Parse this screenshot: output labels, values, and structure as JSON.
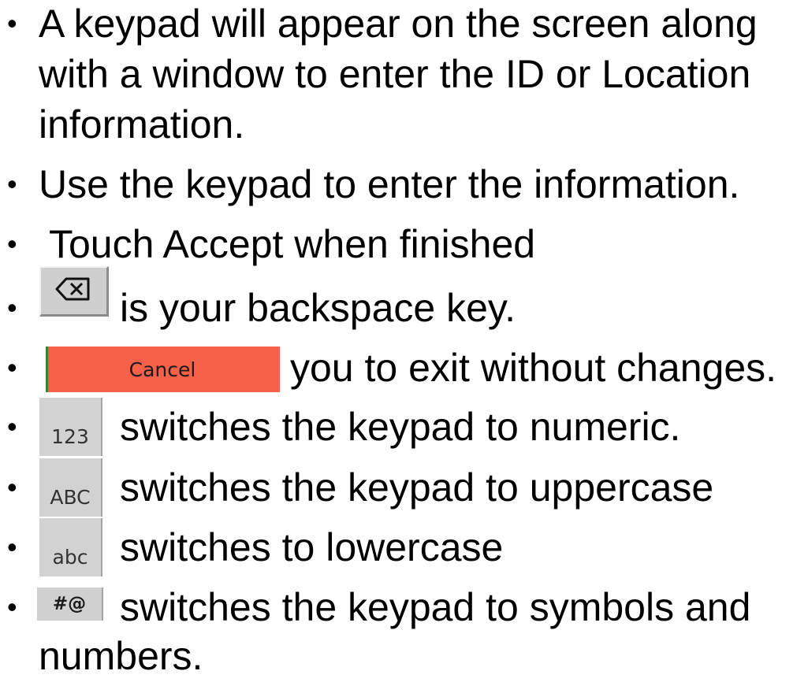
{
  "items": [
    {
      "bullet": "•",
      "lines": [
        "A keypad will appear on the screen along",
        "with a window to enter the ID or Location",
        "information."
      ]
    },
    {
      "bullet": "•",
      "text": "Use the keypad to enter the information."
    },
    {
      "bullet": "•",
      "text": "Touch Accept when finished"
    },
    {
      "bullet": "•",
      "key_icon": "backspace-icon",
      "text": "is your backspace key."
    },
    {
      "bullet": "•",
      "key_label": "Cancel",
      "key_color": "#f76049",
      "text": "you to exit without changes."
    },
    {
      "bullet": "•",
      "key_label": "123",
      "text": "switches the keypad to numeric."
    },
    {
      "bullet": "•",
      "key_label": "ABC",
      "text": "switches the keypad to uppercase"
    },
    {
      "bullet": "•",
      "key_label": "abc",
      "text": "switches to lowercase"
    },
    {
      "bullet": "•",
      "key_label": "#@",
      "lines": [
        "switches the keypad to symbols and",
        "numbers."
      ]
    }
  ]
}
